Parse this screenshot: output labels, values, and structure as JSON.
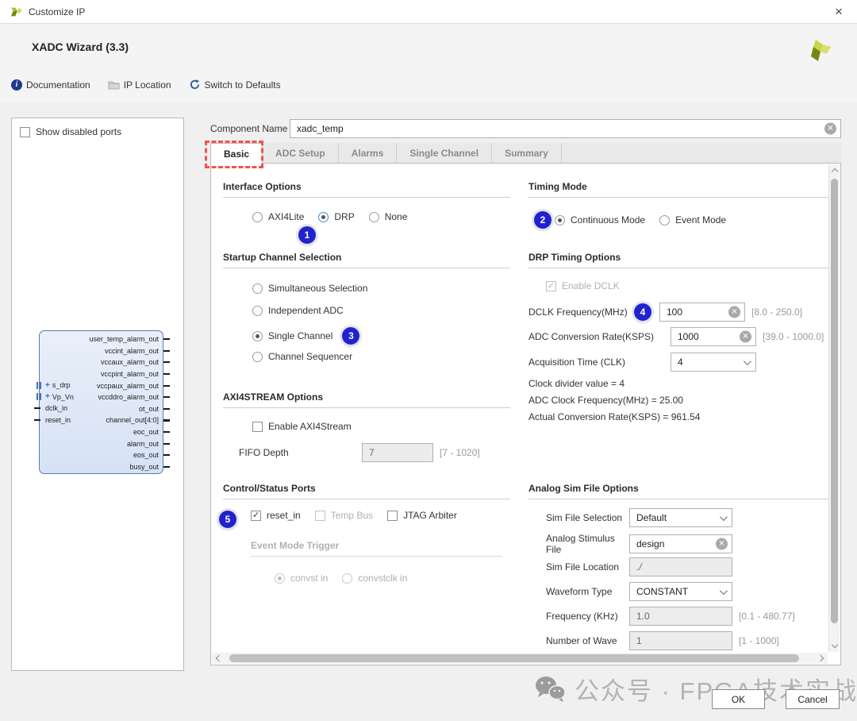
{
  "window": {
    "title": "Customize IP"
  },
  "header": {
    "title": "XADC Wizard (3.3)"
  },
  "toolbar": {
    "documentation": "Documentation",
    "ip_location": "IP Location",
    "switch_to_defaults": "Switch to Defaults"
  },
  "left_panel": {
    "show_disabled_ports": "Show disabled ports",
    "diagram": {
      "left_ports": [
        {
          "label": "s_drp",
          "type": "bus"
        },
        {
          "label": "Vp_Vn",
          "type": "bus"
        },
        {
          "label": "dclk_in",
          "type": "pin"
        },
        {
          "label": "reset_in",
          "type": "pin"
        }
      ],
      "right_ports": [
        "user_temp_alarm_out",
        "vccint_alarm_out",
        "vccaux_alarm_out",
        "vccpint_alarm_out",
        "vccpaux_alarm_out",
        "vccddro_alarm_out",
        "ot_out",
        "channel_out[4:0]",
        "eoc_out",
        "alarm_out",
        "eos_out",
        "busy_out"
      ]
    }
  },
  "component_name": {
    "label": "Component Name",
    "value": "xadc_temp"
  },
  "tabs": {
    "basic": "Basic",
    "adc_setup": "ADC Setup",
    "alarms": "Alarms",
    "single_channel": "Single Channel",
    "summary": "Summary"
  },
  "annotations": {
    "b1": "1",
    "b2": "2",
    "b3": "3",
    "b4": "4",
    "b5": "5"
  },
  "interface_options": {
    "title": "Interface Options",
    "axi4lite": "AXI4Lite",
    "drp": "DRP",
    "none": "None"
  },
  "startup_channel": {
    "title": "Startup Channel Selection",
    "simultaneous": "Simultaneous Selection",
    "independent": "Independent ADC",
    "single_channel": "Single Channel",
    "channel_sequencer": "Channel Sequencer"
  },
  "axi4stream": {
    "title": "AXI4STREAM Options",
    "enable": "Enable AXI4Stream",
    "fifo_label": "FIFO Depth",
    "fifo_value": "7",
    "fifo_range": "[7 - 1020]"
  },
  "control_status": {
    "title": "Control/Status Ports",
    "reset_in": "reset_in",
    "temp_bus": "Temp Bus",
    "jtag": "JTAG Arbiter",
    "event_trigger_title": "Event Mode Trigger",
    "convst": "convst in",
    "convstclk": "convstclk in"
  },
  "timing_mode": {
    "title": "Timing Mode",
    "continuous": "Continuous Mode",
    "event": "Event Mode"
  },
  "drp_timing": {
    "title": "DRP Timing Options",
    "enable_dclk": "Enable DCLK",
    "dclk_label": "DCLK Frequency(MHz)",
    "dclk_value": "100",
    "dclk_range": "[8.0 - 250.0]",
    "adc_label": "ADC Conversion Rate(KSPS)",
    "adc_value": "1000",
    "adc_range": "[39.0 - 1000.0]",
    "acq_label": "Acquisition Time (CLK)",
    "acq_value": "4",
    "info1": "Clock divider value = 4",
    "info2": "ADC Clock Frequency(MHz) = 25.00",
    "info3": "Actual Conversion Rate(KSPS) = 961.54"
  },
  "analog_sim": {
    "title": "Analog Sim File Options",
    "sim_file_selection_label": "Sim File Selection",
    "sim_file_selection_value": "Default",
    "stimulus_label": "Analog Stimulus File",
    "stimulus_value": "design",
    "location_label": "Sim File Location",
    "location_value": "./",
    "waveform_label": "Waveform Type",
    "waveform_value": "CONSTANT",
    "freq_label": "Frequency (KHz)",
    "freq_value": "1.0",
    "freq_range": "[0.1 - 480.77]",
    "wave_label": "Number of Wave",
    "wave_value": "1",
    "wave_range": "[1 - 1000]"
  },
  "footer": {
    "ok": "OK",
    "cancel": "Cancel",
    "watermark": "公众号 · FPGA技术实战"
  },
  "colors": {
    "accent_blue": "#2023cc",
    "annotation_red": "#f2514f",
    "logo_green": "#b6c52a"
  }
}
